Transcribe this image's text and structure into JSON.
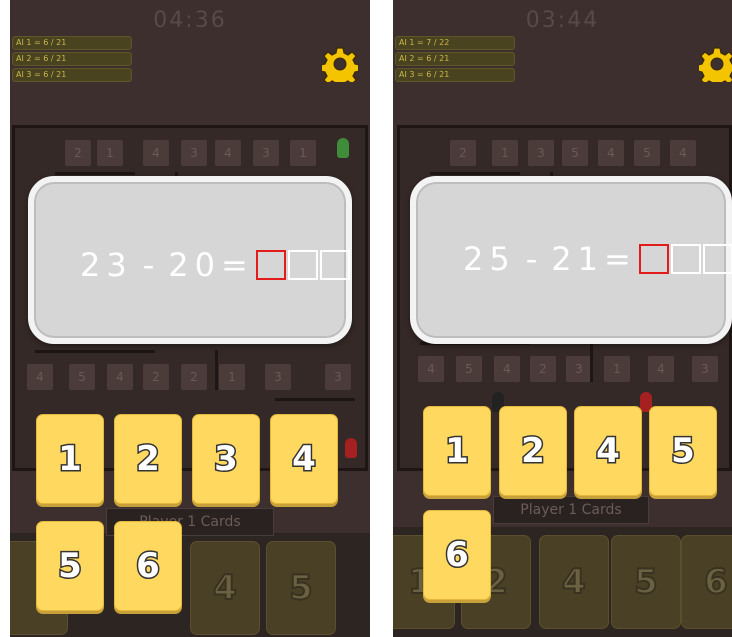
{
  "colors": {
    "card_yellow": "#ffd860",
    "active_box": "#e21b1b",
    "panel_bg": "#3c2f2d"
  },
  "screens": [
    {
      "timer": "04:36",
      "ai_scores": [
        "AI 1 = 6 / 21",
        "AI 2 = 6 / 21",
        "AI 3 = 6 / 21"
      ],
      "equation": {
        "a": "23",
        "op": "-",
        "b": "20",
        "eq": "="
      },
      "answer_boxes": 3,
      "cards": [
        "1",
        "2",
        "3",
        "4",
        "5",
        "6"
      ],
      "player_label": "Player 1 Cards",
      "bottom_cards": [
        "",
        "",
        "4",
        "5"
      ],
      "board_numbers": [
        "2",
        "1",
        "4",
        "3",
        "4",
        "3",
        "1",
        "4",
        "5",
        "4",
        "2",
        "2",
        "1",
        "3",
        "3"
      ]
    },
    {
      "timer": "03:44",
      "ai_scores": [
        "AI 1 = 7 / 22",
        "AI 2 = 6 / 21",
        "AI 3 = 6 / 21"
      ],
      "equation": {
        "a": "25",
        "op": "-",
        "b": "21",
        "eq": "="
      },
      "answer_boxes": 3,
      "cards": [
        "1",
        "2",
        "4",
        "5",
        "6"
      ],
      "player_label": "Player 1 Cards",
      "bottom_cards": [
        "1",
        "2",
        "4",
        "5",
        "6"
      ],
      "board_numbers": [
        "2",
        "1",
        "3",
        "5",
        "4",
        "5",
        "4",
        "4",
        "5",
        "4",
        "2",
        "3",
        "1",
        "4",
        "3"
      ]
    }
  ]
}
